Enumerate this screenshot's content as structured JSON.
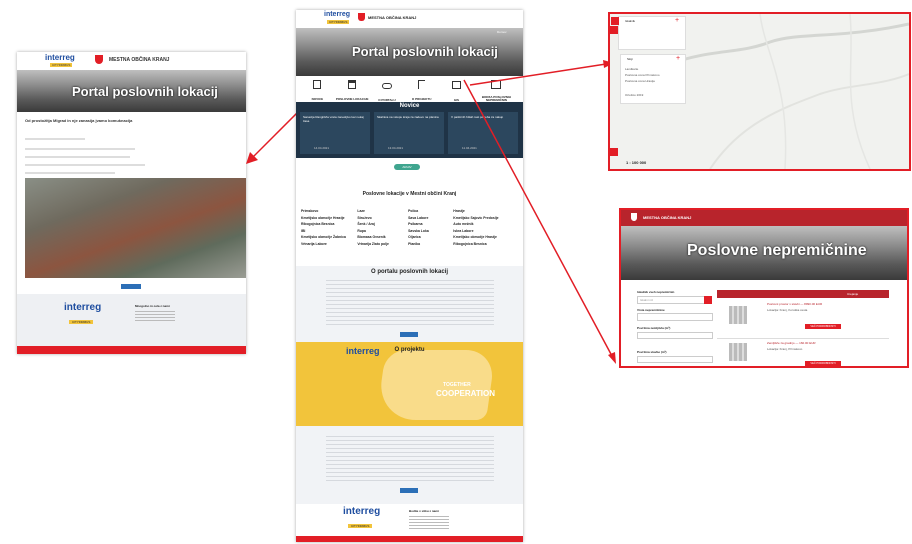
{
  "brand": {
    "org": "MESTNA OBČINA KRANJ",
    "program": "interreg",
    "program_sub": "CENTRAL EUROPE",
    "project": "CITYFIRMUS",
    "colors": {
      "red": "#e21e26",
      "navy": "#1f3346",
      "teal": "#3fa58f",
      "yellow": "#f2c43b",
      "blue": "#2c6fb7"
    }
  },
  "left_page": {
    "banner_title": "Portal poslovnih lokacij",
    "heading": "Od prostožitja Mlgrad in nje zanasija jvamo komuknacija",
    "footer_title": "Mnogolno in cela z nami"
  },
  "center_page": {
    "banner_title": "Portal poslovnih lokacij",
    "top_link": "Domov",
    "nav": [
      {
        "label": "NOVICE",
        "icon": "newspaper-icon"
      },
      {
        "label": "POSLOVNE LOKACIJE",
        "icon": "buildings-icon"
      },
      {
        "label": "O PORTALU",
        "icon": "handshake-icon"
      },
      {
        "label": "O PROJEKTU",
        "icon": "flag-icon"
      },
      {
        "label": "GIS",
        "icon": "map-icon"
      },
      {
        "label": "BORZA POSLOVNIH NEPREMIČNIN",
        "icon": "office-icon"
      }
    ],
    "news_title": "Novice",
    "news": [
      {
        "title": "Sanacija Rangiršča vzela zanesljivo kar nekaj časa",
        "date": "14.04.2021"
      },
      {
        "title": "Skalnica na vstopu kraja za zadevo na planina",
        "date": "13.04.2021"
      },
      {
        "title": "V parkirnih hišah rast potreba za nakup",
        "date": "11.04.2021"
      }
    ],
    "more_button": "ARHIV",
    "locations_title": "Poslovne lokacije v Mestni občini Kranj",
    "locations_col1": [
      "Primskovo",
      "Kmetijsko območje Hrastje",
      "Ribogojnica Besnica",
      "IBI",
      "Kmetijsko območje Žabnica",
      "Vrtnarija Labore"
    ],
    "locations_col2": [
      "Laze",
      "Struževo",
      "Šenk / Araj",
      "Rupa",
      "Biomasa Ovsenik",
      "Vrtnarija Zlato polje"
    ],
    "locations_col3": [
      "Polica",
      "Sava Labore",
      "Psibarna",
      "Savska Loka",
      "Oljarica",
      "Planika"
    ],
    "locations_col4": [
      "Hrastje",
      "Kmetijsko Sajovic Predoslje",
      "Auto mežnik",
      "Iskra Labore",
      "Kmetijsko območje Hrastje",
      "Ribogojnica Besnica"
    ],
    "about_portal_title": "O portalu poslovnih lokacij",
    "about_project_title": "O projektu",
    "map_overlay": "COOPERATION",
    "map_overlay_top": "TOGETHER",
    "footer_title": "Bodite v stiku z nami"
  },
  "gis_panel": {
    "search_label": "Iskalnik",
    "layers_label": "Sloji",
    "layer_items": [
      "Landkarte",
      "Poslovna cona Primskovo",
      "Poslovna cona Hrastje"
    ],
    "bottom_label": "Ortofoto 2019",
    "scale": "1 : 100 000"
  },
  "realestate_page": {
    "org": "MESTNA OBČINA KRANJ",
    "banner_title": "Poslovne nepremičnine",
    "filter_heading": "Iskalnik vseh nepremičnin",
    "filter_placeholder": "Iskalni niz",
    "filter_labels": [
      "Vrsta nepremičnine",
      "Površina zemljišča (m²)",
      "Površina stavbe (m²)"
    ],
    "results_header": "Urejanje",
    "listings": [
      {
        "title": "Poslovni prostor v stavbi — 8990.00 EUR",
        "detail": "Lokacija: Kranj, Koroška cesta",
        "button": "VEČ PODROBNOSTI"
      },
      {
        "title": "Zemljišče za gradnjo — 160.00 EUR",
        "detail": "Lokacija: Kranj, Primskovo",
        "button": "VEČ PODROBNOSTI"
      }
    ]
  }
}
